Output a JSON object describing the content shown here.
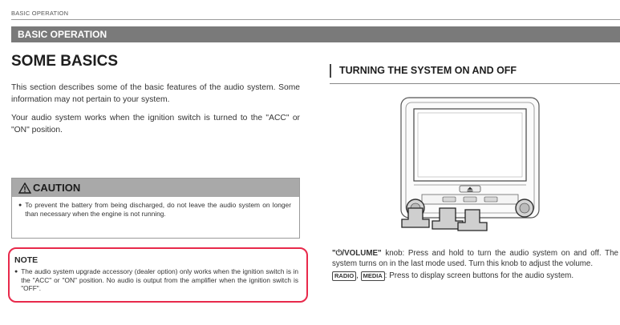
{
  "running_head": "BASIC OPERATION",
  "section_bar": "BASIC OPERATION",
  "left": {
    "title": "SOME BASICS",
    "para1": "This section describes some of the basic features of the audio system. Some information may not pertain to your system.",
    "para2": "Your audio system works when the ignition switch is turned to the \"ACC\" or \"ON\" position."
  },
  "caution": {
    "title": "CAUTION",
    "text": "To prevent the battery from being discharged, do not leave the audio system on longer than necessary when the engine is not running."
  },
  "note": {
    "title": "NOTE",
    "text": "The audio system upgrade accessory (dealer option) only works when the ignition switch is in the \"ACC\" or \"ON\" position. No audio is output from the amplifier when the ignition switch is \"OFF\"."
  },
  "right": {
    "heading": "TURNING THE SYSTEM ON AND OFF",
    "knob_label": "\"⏻/VOLUME\"",
    "knob_text": " knob: Press and hold to turn the audio system on and off. The system turns on in the last mode used. Turn this knob to adjust the volume.",
    "btn_radio": "RADIO",
    "btn_media": "MEDIA",
    "btn_text": ": Press to display screen buttons for the audio system."
  },
  "icons": {
    "warning": "warning-triangle-icon",
    "power": "power-icon"
  },
  "colors": {
    "section_bar": "#7a7a7a",
    "caution_header": "#a9a9a9",
    "note_highlight": "#e8294b"
  }
}
